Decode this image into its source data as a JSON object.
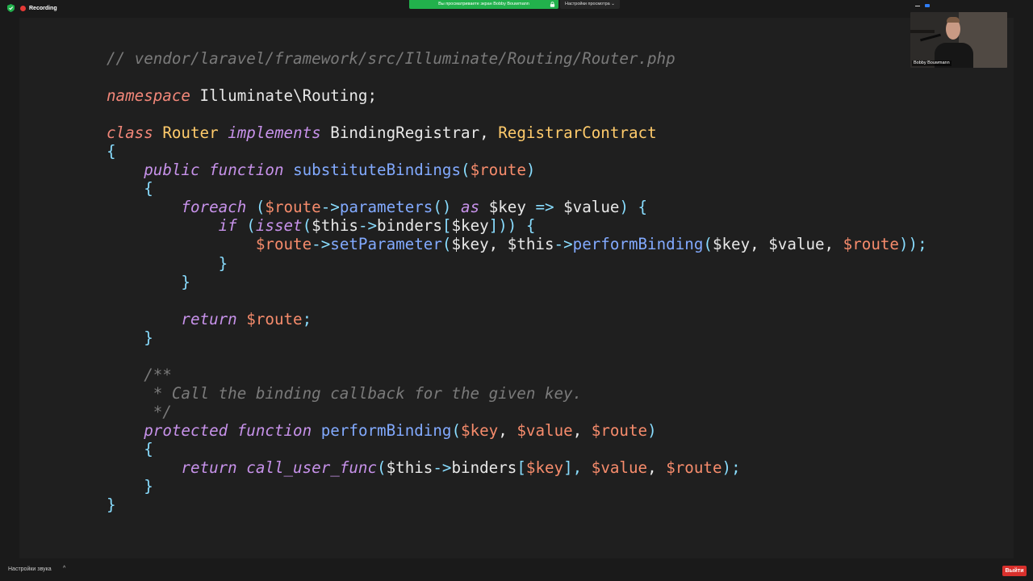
{
  "topbar": {
    "recording_label": "Recording",
    "share_banner": "Вы просматриваете экран Bobby Bouwmann",
    "view_options": "Настройки просмотра ⌄"
  },
  "video": {
    "name": "Bobby Bouwmann"
  },
  "bottombar": {
    "audio_settings": "Настройки звука",
    "audio_caret": "^",
    "leave_label": "Выйти"
  },
  "colors": {
    "recording": "#e53935",
    "share_banner": "#22b14c",
    "leave": "#d9302c",
    "keyword": "#f28779",
    "keyword_alt": "#c792ea",
    "class": "#ffcb6b",
    "function": "#82aaff",
    "variable": "#f78c6c",
    "comment": "#7a7a7a"
  },
  "code": {
    "lines": [
      [
        [
          "// vendor/laravel/framework/src/Illuminate/Routing/Router.php",
          "comment"
        ]
      ],
      [],
      [
        [
          "namespace",
          "kw"
        ],
        [
          " Illuminate\\Routing;",
          "plain"
        ]
      ],
      [],
      [
        [
          "class",
          "kw"
        ],
        [
          " ",
          "plain"
        ],
        [
          "Router",
          "cls"
        ],
        [
          " ",
          "plain"
        ],
        [
          "implements",
          "kw2"
        ],
        [
          " BindingRegistrar, ",
          "plain"
        ],
        [
          "RegistrarContract",
          "cls"
        ]
      ],
      [
        [
          "{",
          "op"
        ]
      ],
      [
        [
          "    ",
          "plain"
        ],
        [
          "public",
          "kw2"
        ],
        [
          " ",
          "plain"
        ],
        [
          "function",
          "kw2"
        ],
        [
          " ",
          "plain"
        ],
        [
          "substituteBindings",
          "fn"
        ],
        [
          "(",
          "op"
        ],
        [
          "$route",
          "var"
        ],
        [
          ")",
          "op"
        ]
      ],
      [
        [
          "    ",
          "plain"
        ],
        [
          "{",
          "op"
        ]
      ],
      [
        [
          "        ",
          "plain"
        ],
        [
          "foreach",
          "kw2"
        ],
        [
          " (",
          "op"
        ],
        [
          "$route",
          "var"
        ],
        [
          "->",
          "op"
        ],
        [
          "parameters",
          "fn"
        ],
        [
          "()",
          "op"
        ],
        [
          " ",
          "plain"
        ],
        [
          "as",
          "kw2"
        ],
        [
          " $key ",
          "plain"
        ],
        [
          "=>",
          "op"
        ],
        [
          " $value",
          "plain"
        ],
        [
          ") {",
          "op"
        ]
      ],
      [
        [
          "            ",
          "plain"
        ],
        [
          "if",
          "kw2"
        ],
        [
          " (",
          "op"
        ],
        [
          "isset",
          "kw2"
        ],
        [
          "(",
          "op"
        ],
        [
          "$this",
          "plain"
        ],
        [
          "->",
          "op"
        ],
        [
          "binders",
          "plain"
        ],
        [
          "[",
          "op"
        ],
        [
          "$key",
          "plain"
        ],
        [
          "])) {",
          "op"
        ]
      ],
      [
        [
          "                ",
          "plain"
        ],
        [
          "$route",
          "var"
        ],
        [
          "->",
          "op"
        ],
        [
          "setParameter",
          "fn"
        ],
        [
          "(",
          "op"
        ],
        [
          "$key, $this",
          "plain"
        ],
        [
          "->",
          "op"
        ],
        [
          "performBinding",
          "fn"
        ],
        [
          "(",
          "op"
        ],
        [
          "$key, $value, ",
          "plain"
        ],
        [
          "$route",
          "var"
        ],
        [
          "));",
          "op"
        ]
      ],
      [
        [
          "            ",
          "plain"
        ],
        [
          "}",
          "op"
        ]
      ],
      [
        [
          "        ",
          "plain"
        ],
        [
          "}",
          "op"
        ]
      ],
      [],
      [
        [
          "        ",
          "plain"
        ],
        [
          "return",
          "kw2"
        ],
        [
          " ",
          "plain"
        ],
        [
          "$route",
          "var"
        ],
        [
          ";",
          "op"
        ]
      ],
      [
        [
          "    ",
          "plain"
        ],
        [
          "}",
          "op"
        ]
      ],
      [],
      [
        [
          "    /**",
          "comment"
        ]
      ],
      [
        [
          "     * Call the binding callback for the given key.",
          "comment"
        ]
      ],
      [
        [
          "     */",
          "comment"
        ]
      ],
      [
        [
          "    ",
          "plain"
        ],
        [
          "protected",
          "kw2"
        ],
        [
          " ",
          "plain"
        ],
        [
          "function",
          "kw2"
        ],
        [
          " ",
          "plain"
        ],
        [
          "performBinding",
          "fn"
        ],
        [
          "(",
          "op"
        ],
        [
          "$key",
          "var"
        ],
        [
          ", ",
          "plain"
        ],
        [
          "$value",
          "var"
        ],
        [
          ", ",
          "plain"
        ],
        [
          "$route",
          "var"
        ],
        [
          ")",
          "op"
        ]
      ],
      [
        [
          "    ",
          "plain"
        ],
        [
          "{",
          "op"
        ]
      ],
      [
        [
          "        ",
          "plain"
        ],
        [
          "return",
          "kw2"
        ],
        [
          " ",
          "plain"
        ],
        [
          "call_user_func",
          "kw2"
        ],
        [
          "(",
          "op"
        ],
        [
          "$this",
          "plain"
        ],
        [
          "->",
          "op"
        ],
        [
          "binders",
          "plain"
        ],
        [
          "[",
          "op"
        ],
        [
          "$key",
          "var"
        ],
        [
          "], ",
          "op"
        ],
        [
          "$value",
          "var"
        ],
        [
          ", ",
          "plain"
        ],
        [
          "$route",
          "var"
        ],
        [
          ");",
          "op"
        ]
      ],
      [
        [
          "    ",
          "plain"
        ],
        [
          "}",
          "op"
        ]
      ],
      [
        [
          "}",
          "op"
        ]
      ]
    ]
  }
}
